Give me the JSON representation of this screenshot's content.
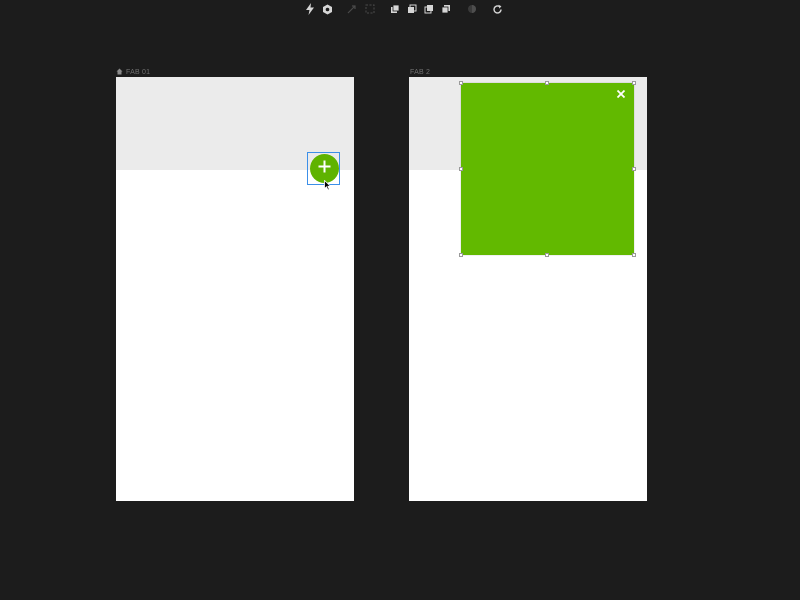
{
  "toolbar": {
    "icons": [
      "lightning-icon",
      "settings-gear-icon",
      "pen-tool-icon",
      "crop-frame-icon",
      "bring-to-front-icon",
      "bring-forward-icon",
      "send-backward-icon",
      "send-to-back-icon",
      "opacity-icon",
      "refresh-icon"
    ]
  },
  "artboards": [
    {
      "label": "FAB 01",
      "is_home": true
    },
    {
      "label": "FAB 2",
      "is_home": false
    }
  ],
  "colors": {
    "background": "#1c1c1c",
    "accent_green": "#62b900",
    "selection_blue": "#3c8fe8",
    "header_band": "#ebebeb"
  },
  "fab": {
    "icon": "plus-icon"
  },
  "panel": {
    "close_icon": "close-icon"
  }
}
